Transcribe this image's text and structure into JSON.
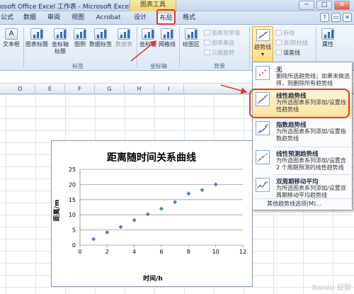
{
  "window": {
    "title": "osoft Office Excel 工作表 - Microsoft Excel",
    "contextual_tab_group": "图表工具",
    "buttons": [
      "─",
      "□",
      "✕"
    ]
  },
  "tabs": [
    "公式",
    "数据",
    "审阅",
    "视图",
    "Acrobat",
    "设计",
    "布局",
    "格式"
  ],
  "active_tab": "布局",
  "ribbon": {
    "buttons": [
      "文本框",
      "图表标题",
      "坐标轴标题",
      "图例",
      "数据标签",
      "数据表",
      "坐标轴",
      "网格线",
      "绘图区",
      "趋势线",
      "属性"
    ],
    "small_items": [
      "图表背景墙",
      "图表基底",
      "三维旋转",
      "折线",
      "涨/跌柱线",
      "误差线"
    ],
    "groups": [
      "标签",
      "坐标轴",
      "背景"
    ]
  },
  "columns": [
    "D",
    "E",
    "F",
    "G",
    "H",
    "I"
  ],
  "chart_data": {
    "type": "scatter",
    "title": "距离随时间关系曲线",
    "xlabel": "时间/h",
    "ylabel": "距离/m",
    "xlim": [
      0,
      12
    ],
    "ylim": [
      0,
      25
    ],
    "xticks": [
      "0",
      "2",
      "4",
      "6",
      "8",
      "10",
      "12"
    ],
    "yticks": [
      "0",
      "5",
      "10",
      "15",
      "20",
      "25"
    ],
    "grid": "horizontal",
    "x": [
      1,
      2,
      3,
      4,
      5,
      6,
      7,
      8,
      9,
      10
    ],
    "y": [
      2,
      4.2,
      6,
      8.2,
      10.2,
      12,
      14.2,
      17,
      18.2,
      20
    ],
    "marker_color": "#4f81bd"
  },
  "menu": {
    "items": [
      {
        "title": "无",
        "desc": "删除所选趋势线；如果未做选择，则删除所有趋势线"
      },
      {
        "title": "线性趋势线",
        "desc": "为所选图表系列添加/设置线性趋势线"
      },
      {
        "title": "指数趋势线",
        "desc": "为所选图表系列添加/设置指数趋势线"
      },
      {
        "title": "线性预测趋势线",
        "desc": "为所选图表系列添加/设置含 2 个周期预测的线性趋势线"
      },
      {
        "title": "双周期移动平均",
        "desc": "为所选图表系列添加/设置双周期移动平均趋势线"
      }
    ],
    "more": "其他趋势线选项(M)...",
    "highlighted": "线性趋势线"
  },
  "watermark": "Baidu 经验",
  "colors": {
    "highlight_red": "#e0382f",
    "accent": "#4f81bd"
  }
}
